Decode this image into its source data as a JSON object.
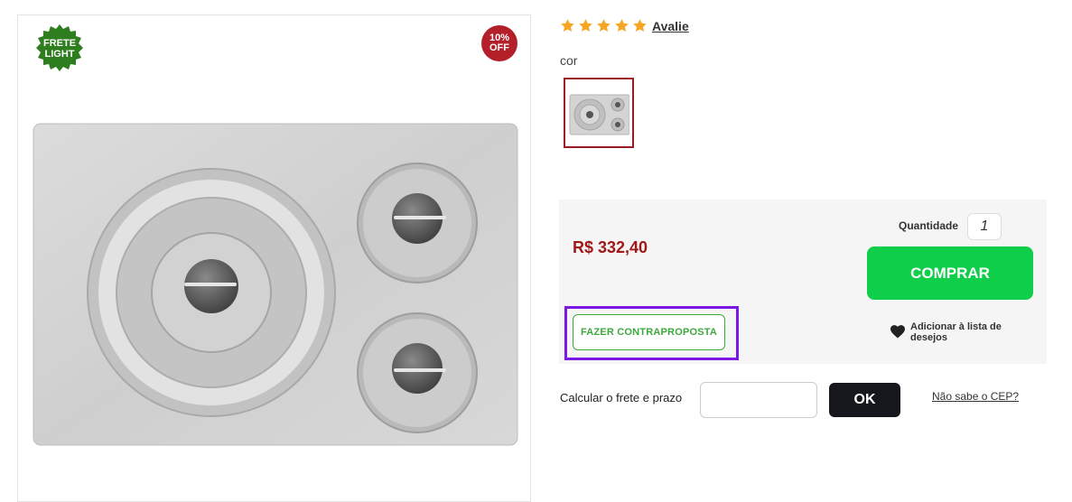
{
  "badges": {
    "frete_line1": "FRETE",
    "frete_line2": "LIGHT",
    "discount_line1": "10%",
    "discount_line2": "OFF"
  },
  "rating": {
    "stars": 5,
    "link_label": "Avalie"
  },
  "variant": {
    "label": "cor"
  },
  "purchase": {
    "price": "R$ 332,40",
    "quantity_label": "Quantidade",
    "quantity_value": "1",
    "buy_label": "COMPRAR",
    "counteroffer_label": "FAZER CONTRAPROPOSTA",
    "wishlist_label": "Adicionar à lista de desejos"
  },
  "shipping": {
    "label": "Calcular o frete e prazo",
    "cep_value": "",
    "ok_label": "OK",
    "unknown_cep_link": "Não sabe o CEP?"
  },
  "colors": {
    "price": "#a01818",
    "buy_button": "#0fcf4a",
    "highlight": "#7b18e6",
    "counteroffer": "#3ca93c",
    "discount_badge": "#b3202a",
    "star": "#f5a623"
  }
}
